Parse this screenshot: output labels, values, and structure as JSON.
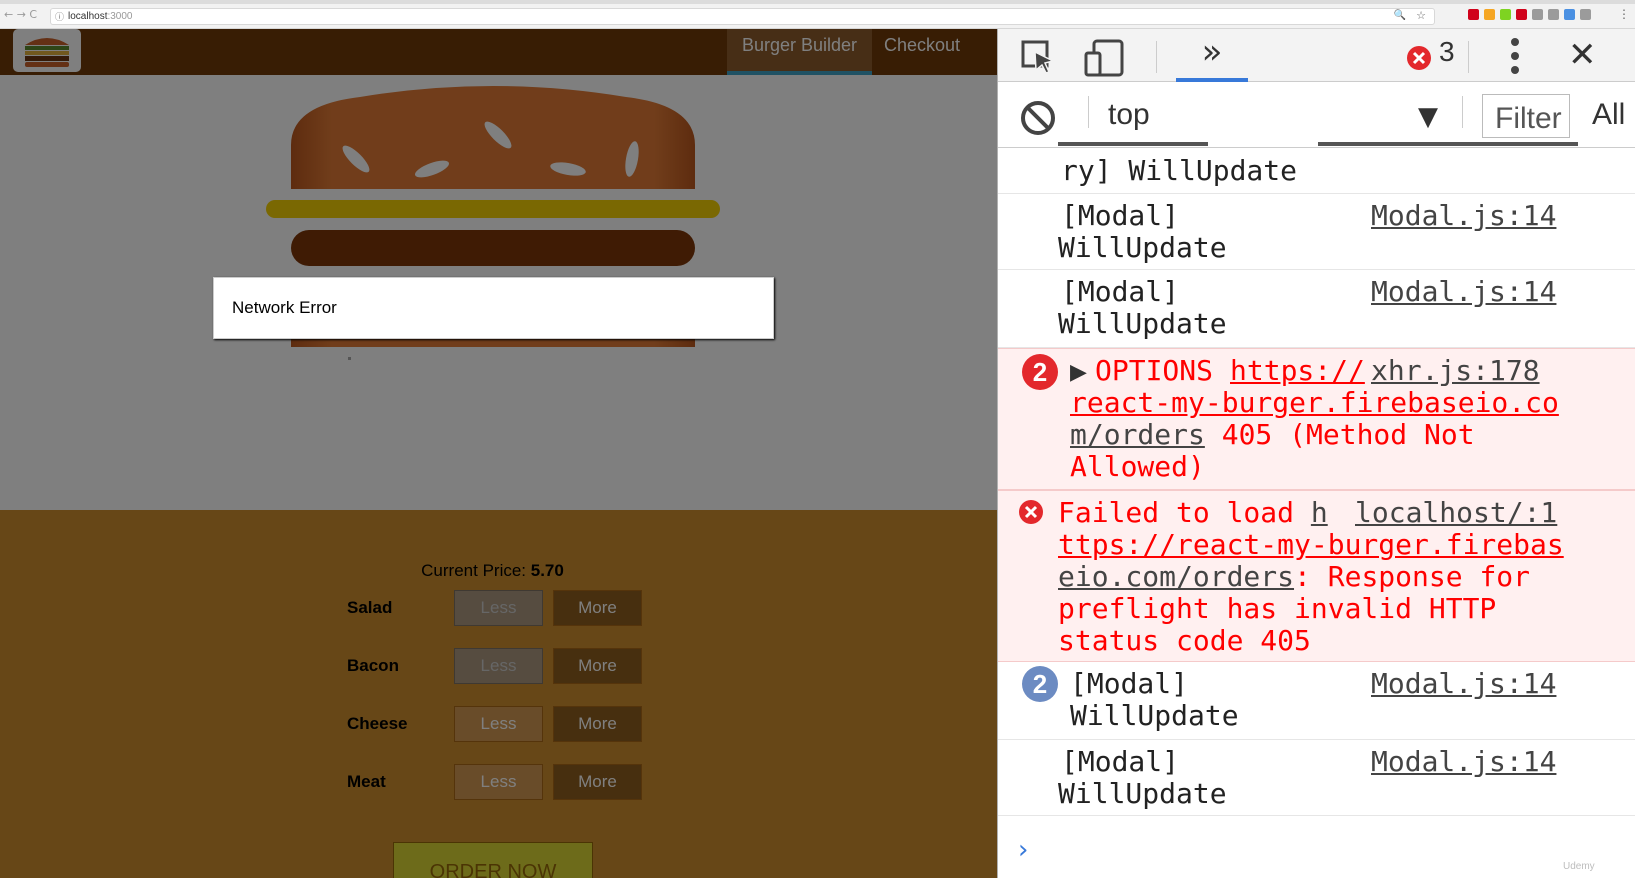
{
  "browser": {
    "nav_glyphs": "← → C",
    "info_icon": "ⓘ",
    "url_host": "localhost",
    "url_port": ":3000",
    "zoom_icon": "🔍",
    "star_icon": "☆",
    "menu_icon": "⋮",
    "extension_colors": [
      "#d0021b",
      "#f5a623",
      "#7ed321",
      "#d0021b",
      "#9b9b9b",
      "#9b9b9b",
      "#4a90e2",
      "#9b9b9b"
    ]
  },
  "app": {
    "nav": {
      "burger_builder": "Burger Builder",
      "checkout": "Checkout"
    },
    "modal_message": "Network Error",
    "price_label": "Current Price: ",
    "price_value": "5.70",
    "controls": [
      {
        "label": "Salad",
        "less": "Less",
        "more": "More",
        "less_disabled": true
      },
      {
        "label": "Bacon",
        "less": "Less",
        "more": "More",
        "less_disabled": true
      },
      {
        "label": "Cheese",
        "less": "Less",
        "more": "More",
        "less_disabled": false
      },
      {
        "label": "Meat",
        "less": "Less",
        "more": "More",
        "less_disabled": false
      }
    ],
    "order_button": "ORDER NOW",
    "colors": {
      "toolbar": "#703b09",
      "controls_bg": "#cf8f2e",
      "order_button": "#dad735",
      "nav_active_border": "#40a4c8"
    }
  },
  "devtools": {
    "more_tabs_glyph": "»",
    "error_count": "3",
    "close_glyph": "✕",
    "context": "top",
    "context_caret": "▼",
    "filter_placeholder": "Filter",
    "levels": "All",
    "console": [
      {
        "type": "log",
        "partial_line": "ry] WillUpdate"
      },
      {
        "type": "log",
        "text_1": "[Modal]",
        "text_2": "WillUpdate",
        "source": "Modal.js:14"
      },
      {
        "type": "log",
        "text_1": "[Modal]",
        "text_2": "WillUpdate",
        "source": "Modal.js:14"
      },
      {
        "type": "error",
        "count": "2",
        "method": "OPTIONS",
        "url_1": "https://",
        "source": "xhr.js:178",
        "url_2": "react-my-burger.firebaseio.co",
        "url_3": "m/orders",
        "status_1": " 405 (Method Not",
        "status_2": "Allowed)"
      },
      {
        "type": "error",
        "text_1": "Failed to load ",
        "url_start": "h",
        "source": "localhost/:1",
        "url_2": "ttps://react-my-burger.firebas",
        "url_3": "eio.com/orders",
        "rest_3": ": Response for",
        "text_4": "preflight has invalid HTTP",
        "text_5": "status code 405"
      },
      {
        "type": "log",
        "count": "2",
        "text_1": "[Modal]",
        "text_2": "WillUpdate",
        "source": "Modal.js:14"
      },
      {
        "type": "log",
        "text_1": "[Modal]",
        "text_2": "WillUpdate",
        "source": "Modal.js:14"
      }
    ],
    "prompt_glyph": "›",
    "watermark": "Udemy"
  }
}
